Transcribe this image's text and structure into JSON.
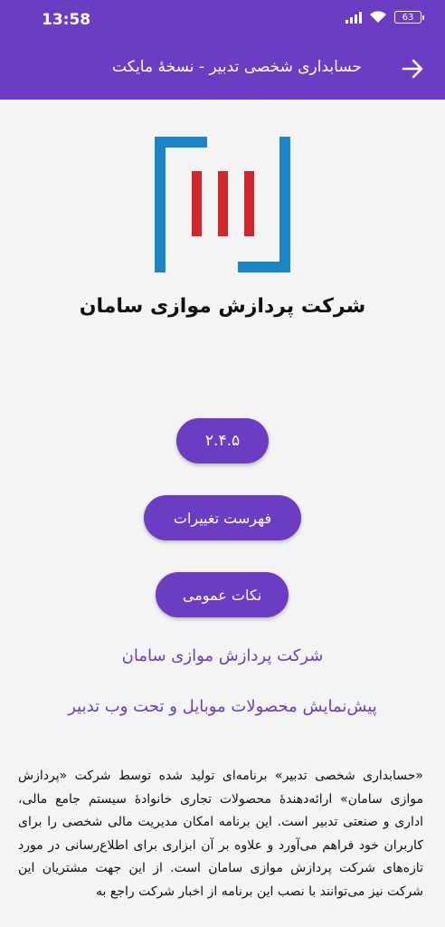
{
  "status_bar": {
    "time": "13:58",
    "battery": "63"
  },
  "app_bar": {
    "title": "حسابداری شخصی تدبیر - نسخهٔ مایکت"
  },
  "about": {
    "company_name": "شرکت پردازش موازی سامان",
    "buttons": {
      "version": "۲.۴.۵",
      "changelog": "فهرست تغییرات",
      "general_notes": "نکات عمومی"
    },
    "company_link": "شرکت پردازش موازی سامان",
    "preview_link": "پیش‌نمایش محصولات موبایل و تحت وب تدبیر",
    "description": "«حسابداری شخصی تدبیر» برنامه‌ای تولید شده توسط شرکت «پردازش موازی سامان» ارائه‌دهندهٔ محصولات تجاری خانوادهٔ سیستم جامع مالی، اداری و صنعتی تدبیر است. این برنامه امکان مدیریت مالی شخصی را برای کاربران خود فراهم می‌آورد و علاوه بر آن ابزاری برای اطلاع‌رسانی در مورد تازه‌های شرکت پردازش موازی سامان است. از این جهت مشتریان این شرکت نیز می‌توانند با نصب این برنامه از اخبار شرکت راجع به"
  },
  "colors": {
    "primary": "#6c3cc2",
    "logo_blue": "#1a86c8",
    "logo_red": "#d0262c"
  }
}
